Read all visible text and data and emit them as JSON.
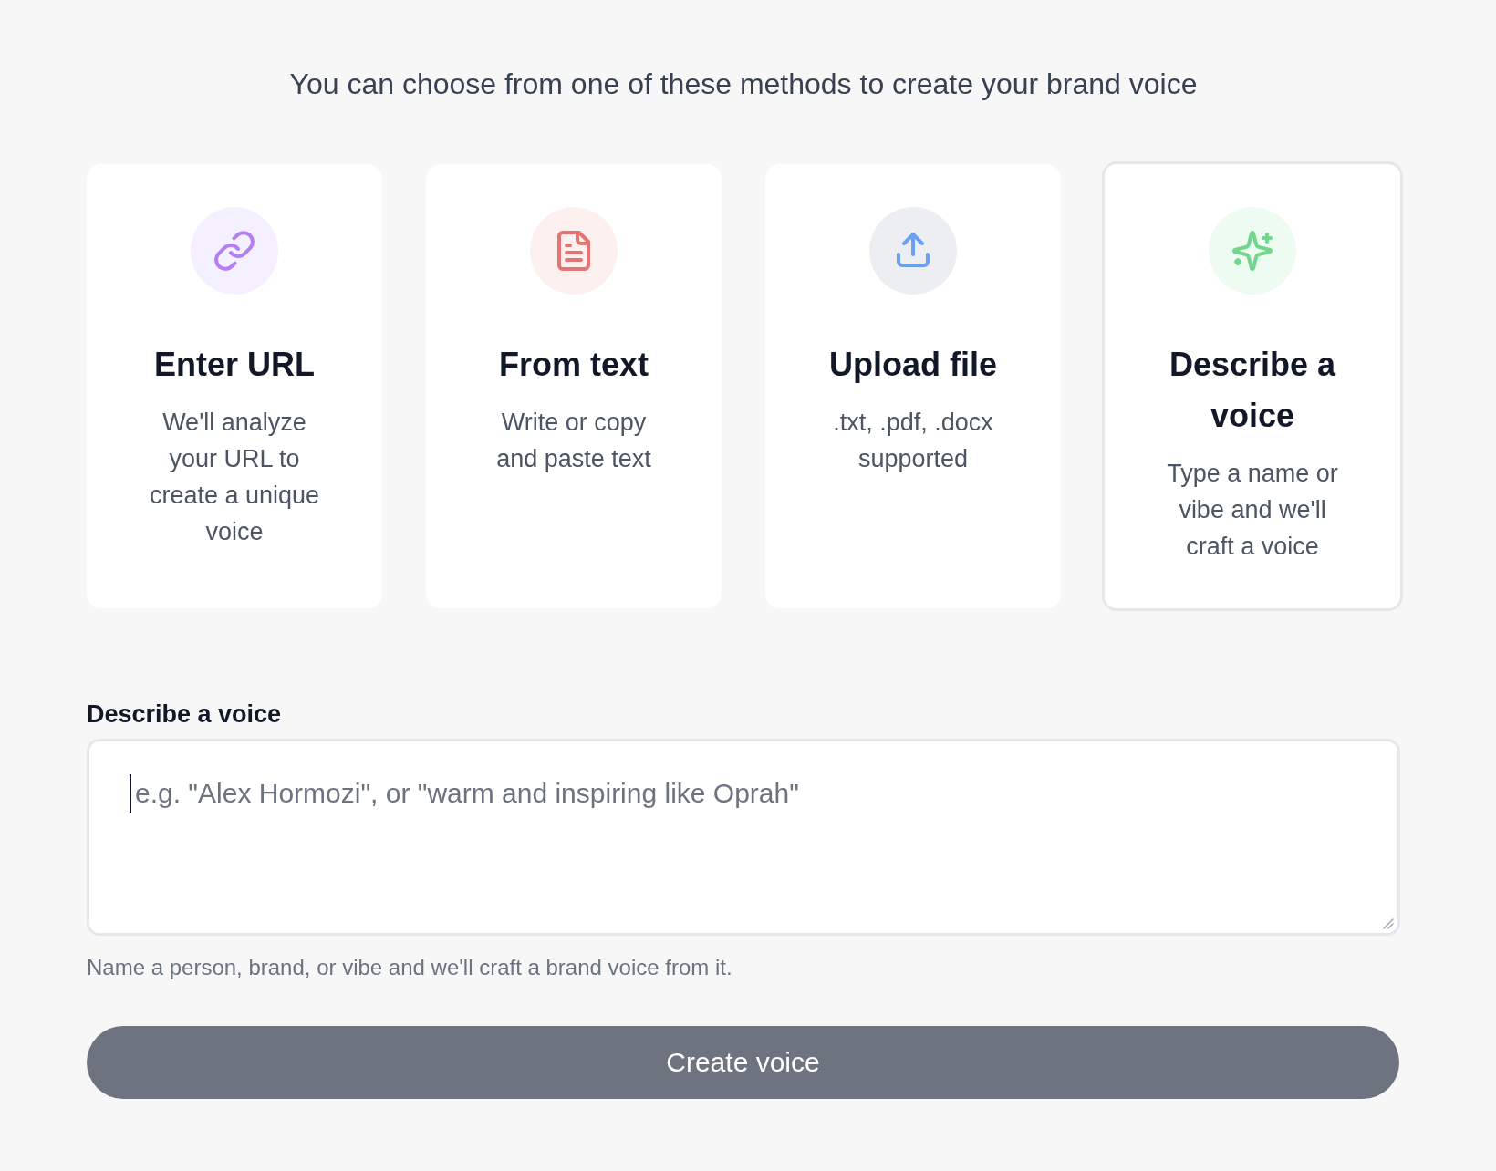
{
  "heading": "You can choose from one of these methods to create your brand voice",
  "methods": [
    {
      "kind": "url",
      "title": "Enter URL",
      "description": "We'll analyze your URL to create a unique voice",
      "selected": false
    },
    {
      "kind": "text",
      "title": "From text",
      "description": "Write or copy and paste text",
      "selected": false
    },
    {
      "kind": "upload",
      "title": "Upload file",
      "description": ".txt, .pdf, .docx supported",
      "selected": false
    },
    {
      "kind": "describe",
      "title": "Describe a voice",
      "description": "Type a name or vibe and we'll craft a voice",
      "selected": true
    }
  ],
  "voice_field": {
    "label": "Describe a voice",
    "placeholder": "e.g. \"Alex Hormozi\", or \"warm and inspiring like Oprah\"",
    "focused": true,
    "hint": "Name a person, brand, or vibe and we'll craft a brand voice from it."
  },
  "submit_button": {
    "label": "Create voice",
    "disabled": true
  }
}
